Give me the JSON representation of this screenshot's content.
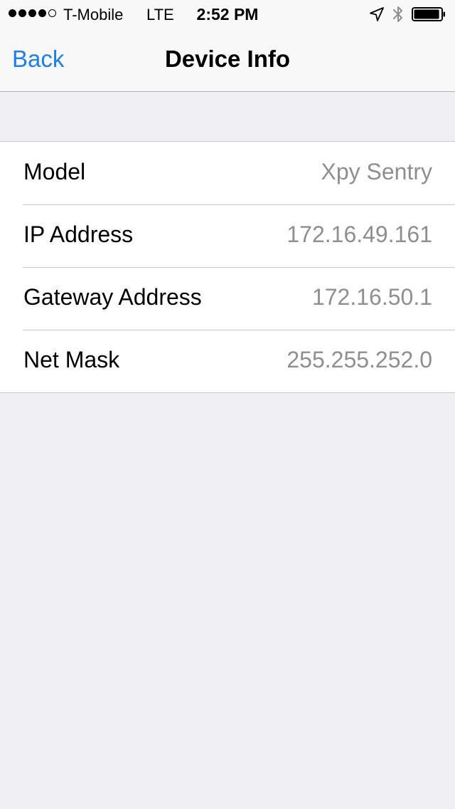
{
  "status_bar": {
    "signal_dots": [
      true,
      true,
      true,
      true,
      false
    ],
    "carrier": "T-Mobile",
    "network": "LTE",
    "time": "2:52 PM",
    "icons": [
      "location-arrow-icon",
      "bluetooth-icon",
      "battery-icon"
    ],
    "battery_level": 0.95
  },
  "nav": {
    "back_label": "Back",
    "title": "Device Info",
    "accent_color": "#1b7ff0"
  },
  "rows": [
    {
      "label": "Model",
      "value": "Xpy Sentry"
    },
    {
      "label": "IP Address",
      "value": "172.16.49.161"
    },
    {
      "label": "Gateway Address",
      "value": "172.16.50.1"
    },
    {
      "label": "Net Mask",
      "value": "255.255.252.0"
    }
  ]
}
